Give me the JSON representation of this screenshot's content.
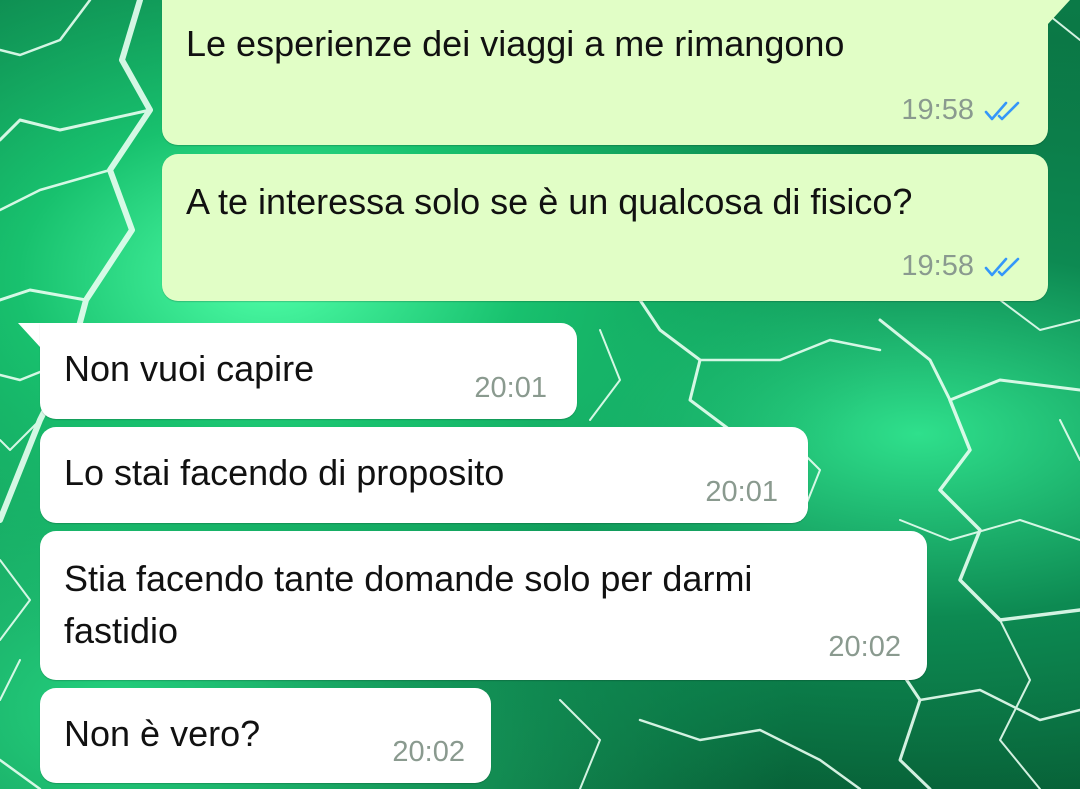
{
  "colors": {
    "outgoing_bubble": "#e1fec6",
    "incoming_bubble": "#ffffff",
    "time_text": "#8a9a8f",
    "read_ticks": "#3497f9",
    "wallpaper": "green lightning"
  },
  "messages": [
    {
      "direction": "outgoing",
      "text": "Le esperienze dei viaggi a me rimangono",
      "time": "19:58",
      "status": "read",
      "status_icon": "double-check-icon"
    },
    {
      "direction": "outgoing",
      "text": "A te interessa solo se è un qualcosa di fisico?",
      "time": "19:58",
      "status": "read",
      "status_icon": "double-check-icon"
    },
    {
      "direction": "incoming",
      "text": "Non vuoi capire",
      "time": "20:01"
    },
    {
      "direction": "incoming",
      "text": "Lo stai facendo di proposito",
      "time": "20:01"
    },
    {
      "direction": "incoming",
      "text": "Stia facendo tante domande solo per darmi fastidio",
      "time": "20:02"
    },
    {
      "direction": "incoming",
      "text": "Non è vero?",
      "time": "20:02"
    }
  ]
}
